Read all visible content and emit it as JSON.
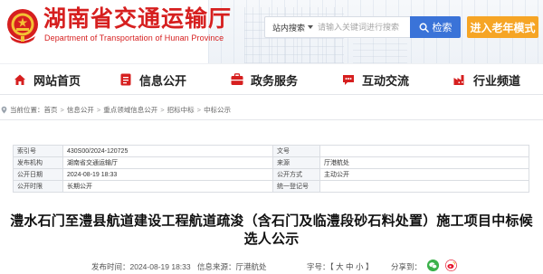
{
  "header": {
    "title": "湖南省交通运输厅",
    "subtitle": "Department of Transportation of Hunan Province",
    "search": {
      "scope": "站内搜索",
      "placeholder": "请输入关键词进行搜索",
      "button": "检索"
    },
    "elder_mode": "进入老年模式",
    "colors": {
      "brand_red": "#d61f1f",
      "search_blue": "#3a73d8",
      "elder_orange": "#f6a525"
    }
  },
  "nav": {
    "items": [
      {
        "label": "网站首页",
        "icon": "home-icon"
      },
      {
        "label": "信息公开",
        "icon": "info-public-icon"
      },
      {
        "label": "政务服务",
        "icon": "service-icon"
      },
      {
        "label": "互动交流",
        "icon": "interaction-icon"
      },
      {
        "label": "行业频道",
        "icon": "industry-icon"
      }
    ]
  },
  "breadcrumb": {
    "prefix": "当前位置：",
    "items": [
      "首页",
      "信息公开",
      "重点领域信息公开",
      "招标中标",
      "中标公示"
    ],
    "separator": ">"
  },
  "meta": {
    "index_no_label": "索引号",
    "index_no": "430S00/2024-120725",
    "doc_no_label": "文号",
    "doc_no": "",
    "publisher_label": "发布机构",
    "publisher": "湖南省交通运输厅",
    "source_label": "来源",
    "source": "厅港航处",
    "date_label": "公开日期",
    "date": "2024-08-19 18:33",
    "method_label": "公开方式",
    "method": "主动公开",
    "scope_label": "公开时限",
    "scope": "长期公开",
    "code_label": "统一登记号",
    "code": ""
  },
  "article": {
    "title": "澧水石门至澧县航道建设工程航道疏浚（含石门及临澧段砂石料处置）施工项目中标候选人公示",
    "publish_line": "发布时间：2024-08-19 18:33",
    "source_line": "信息来源：厅港航处",
    "font_label": "字号：",
    "font_open": "【",
    "font_large": "大",
    "font_medium": "中",
    "font_small": "小",
    "font_close": "】",
    "share_label": "分享到：",
    "share_icons": [
      "wechat-icon",
      "weibo-icon"
    ]
  }
}
